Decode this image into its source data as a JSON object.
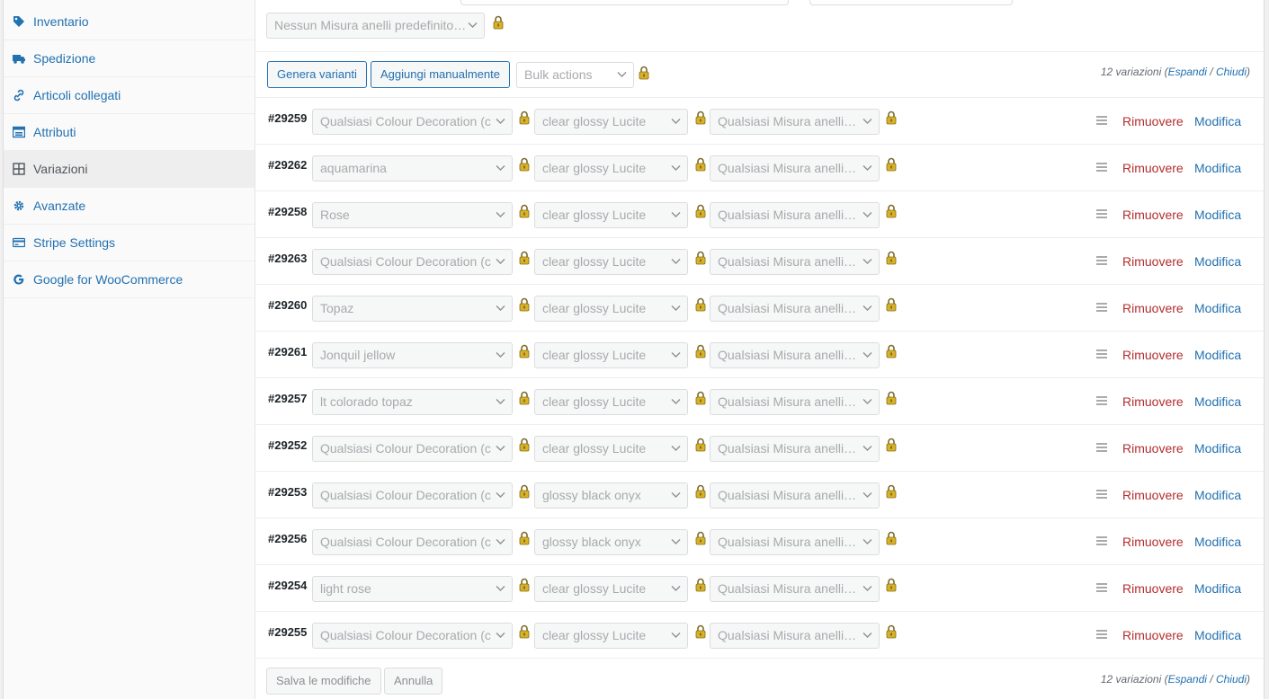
{
  "sidebar": {
    "items": [
      {
        "label": "Inventario",
        "icon": "tag-icon"
      },
      {
        "label": "Spedizione",
        "icon": "truck-icon"
      },
      {
        "label": "Articoli collegati",
        "icon": "link-icon"
      },
      {
        "label": "Attributi",
        "icon": "table-icon"
      },
      {
        "label": "Variazioni",
        "icon": "grid-icon",
        "active": true
      },
      {
        "label": "Avanzate",
        "icon": "gear-icon"
      },
      {
        "label": "Stripe Settings",
        "icon": "card-icon"
      },
      {
        "label": "Google for WooCommerce",
        "icon": "google-icon"
      }
    ]
  },
  "defaults": {
    "ring_size_default": "Nessun Misura anelli predefinito…"
  },
  "toolbar": {
    "generate_label": "Genera varianti",
    "add_manual_label": "Aggiungi manualmente",
    "bulk_actions_placeholder": "Bulk actions",
    "count_text": "12 variazioni (",
    "expand": "Espandi",
    "separator": " / ",
    "close": "Chiudi",
    "close_paren": ")"
  },
  "row_actions": {
    "remove": "Rimuovere",
    "edit": "Modifica"
  },
  "variations": [
    {
      "id": "#29259",
      "colour": "Qualsiasi Colour Decoration (c",
      "finish": "clear glossy Lucite",
      "size": "Qualsiasi Misura anelli…"
    },
    {
      "id": "#29262",
      "colour": "aquamarina",
      "finish": "clear glossy Lucite",
      "size": "Qualsiasi Misura anelli…"
    },
    {
      "id": "#29258",
      "colour": "Rose",
      "finish": "clear glossy Lucite",
      "size": "Qualsiasi Misura anelli…"
    },
    {
      "id": "#29263",
      "colour": "Qualsiasi Colour Decoration (c",
      "finish": "clear glossy Lucite",
      "size": "Qualsiasi Misura anelli…"
    },
    {
      "id": "#29260",
      "colour": "Topaz",
      "finish": "clear glossy Lucite",
      "size": "Qualsiasi Misura anelli…"
    },
    {
      "id": "#29261",
      "colour": "Jonquil jellow",
      "finish": "clear glossy Lucite",
      "size": "Qualsiasi Misura anelli…"
    },
    {
      "id": "#29257",
      "colour": "lt colorado topaz",
      "finish": "clear glossy Lucite",
      "size": "Qualsiasi Misura anelli…"
    },
    {
      "id": "#29252",
      "colour": "Qualsiasi Colour Decoration (c",
      "finish": "clear glossy Lucite",
      "size": "Qualsiasi Misura anelli…"
    },
    {
      "id": "#29253",
      "colour": "Qualsiasi Colour Decoration (c",
      "finish": "glossy black onyx",
      "size": "Qualsiasi Misura anelli…"
    },
    {
      "id": "#29256",
      "colour": "Qualsiasi Colour Decoration (c",
      "finish": "glossy black onyx",
      "size": "Qualsiasi Misura anelli…"
    },
    {
      "id": "#29254",
      "colour": "light rose",
      "finish": "clear glossy Lucite",
      "size": "Qualsiasi Misura anelli…"
    },
    {
      "id": "#29255",
      "colour": "Qualsiasi Colour Decoration (c",
      "finish": "clear glossy Lucite",
      "size": "Qualsiasi Misura anelli…"
    }
  ],
  "footer": {
    "save_label": "Salva le modifiche",
    "cancel_label": "Annulla"
  },
  "colors": {
    "link": "#2271b1",
    "danger": "#b32d2e",
    "muted": "#a7aaad"
  }
}
